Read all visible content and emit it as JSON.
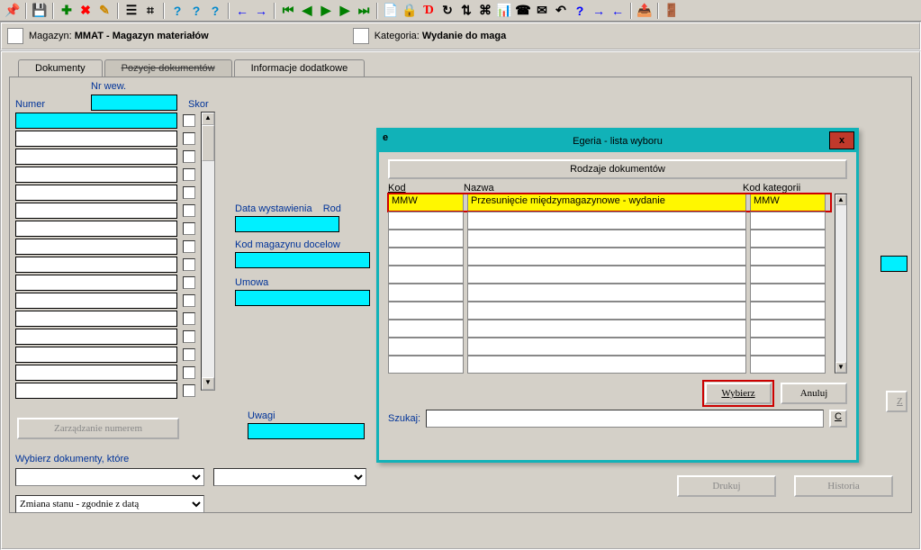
{
  "toolbar": {
    "icons": [
      "pin",
      "save",
      "add-row",
      "del-row",
      "edit-row",
      "tree",
      "org",
      "copy-rec",
      "dup-rec",
      "help-rec",
      "back",
      "fwd",
      "first",
      "prev",
      "play",
      "next",
      "last",
      "doc",
      "lock",
      "letter-d",
      "refresh",
      "sort",
      "tree2",
      "chart",
      "phone",
      "mail",
      "undo-q",
      "question",
      "arrow-r",
      "arrow-l",
      "export",
      "exit"
    ]
  },
  "infobar": {
    "magazyn_label": "Magazyn:",
    "magazyn_value": "MMAT - Magazyn materiałów",
    "kategoria_label": "Kategoria:",
    "kategoria_value": "Wydanie do maga"
  },
  "tabs": {
    "dokumenty": "Dokumenty",
    "pozycje": "Pozycje dokumentów",
    "info": "Informacje dodatkowe"
  },
  "panel": {
    "nr_wew": "Nr wew.",
    "numer": "Numer",
    "skor": "Skor",
    "data_wyst": "Data wystawienia",
    "rod": "Rod",
    "kod_mag": "Kod magazynu docelow",
    "umowa": "Umowa",
    "uwagi": "Uwagi",
    "wybierz_dok": "Wybierz dokumenty, które",
    "zarz_num": "Zarządzanie numerem",
    "drukuj": "Drukuj",
    "historia": "Historia",
    "z_btn": "Z",
    "zmiana_stanu": "Zmiana stanu - zgodnie z datą"
  },
  "dialog": {
    "app": "e",
    "title": "Egeria - lista wyboru",
    "close": "x",
    "header": "Rodzaje dokumentów",
    "col_kod": "Kod",
    "col_nazwa": "Nazwa",
    "col_kat": "Kod kategorii",
    "row": {
      "kod": "MMW",
      "nazwa": "Przesunięcie międzymagazynowe - wydanie",
      "kat": "MMW"
    },
    "wybierz": "Wybierz",
    "anuluj": "Anuluj",
    "szukaj": "Szukaj:",
    "c_btn": "C"
  }
}
